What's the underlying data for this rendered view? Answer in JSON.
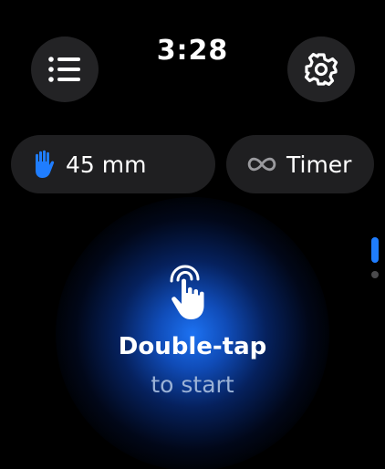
{
  "status": {
    "time": "3:28"
  },
  "toolbar": {
    "menu_icon": "list-icon",
    "settings_icon": "gear-icon"
  },
  "options": {
    "size": {
      "icon": "hand-icon",
      "label": "45 mm",
      "icon_color": "#1f7dff"
    },
    "mode": {
      "icon": "infinity-icon",
      "label": "Timer"
    }
  },
  "hint": {
    "icon": "double-tap-hand-icon",
    "title": "Double-tap",
    "subtitle": "to start"
  },
  "colors": {
    "accent": "#1f7dff",
    "glow": "#1e78ff",
    "subtitle": "#9bb2d6",
    "button_bg": "#232325",
    "pill_bg": "#1f1f21"
  },
  "pager": {
    "active_index": 0,
    "count": 2
  }
}
